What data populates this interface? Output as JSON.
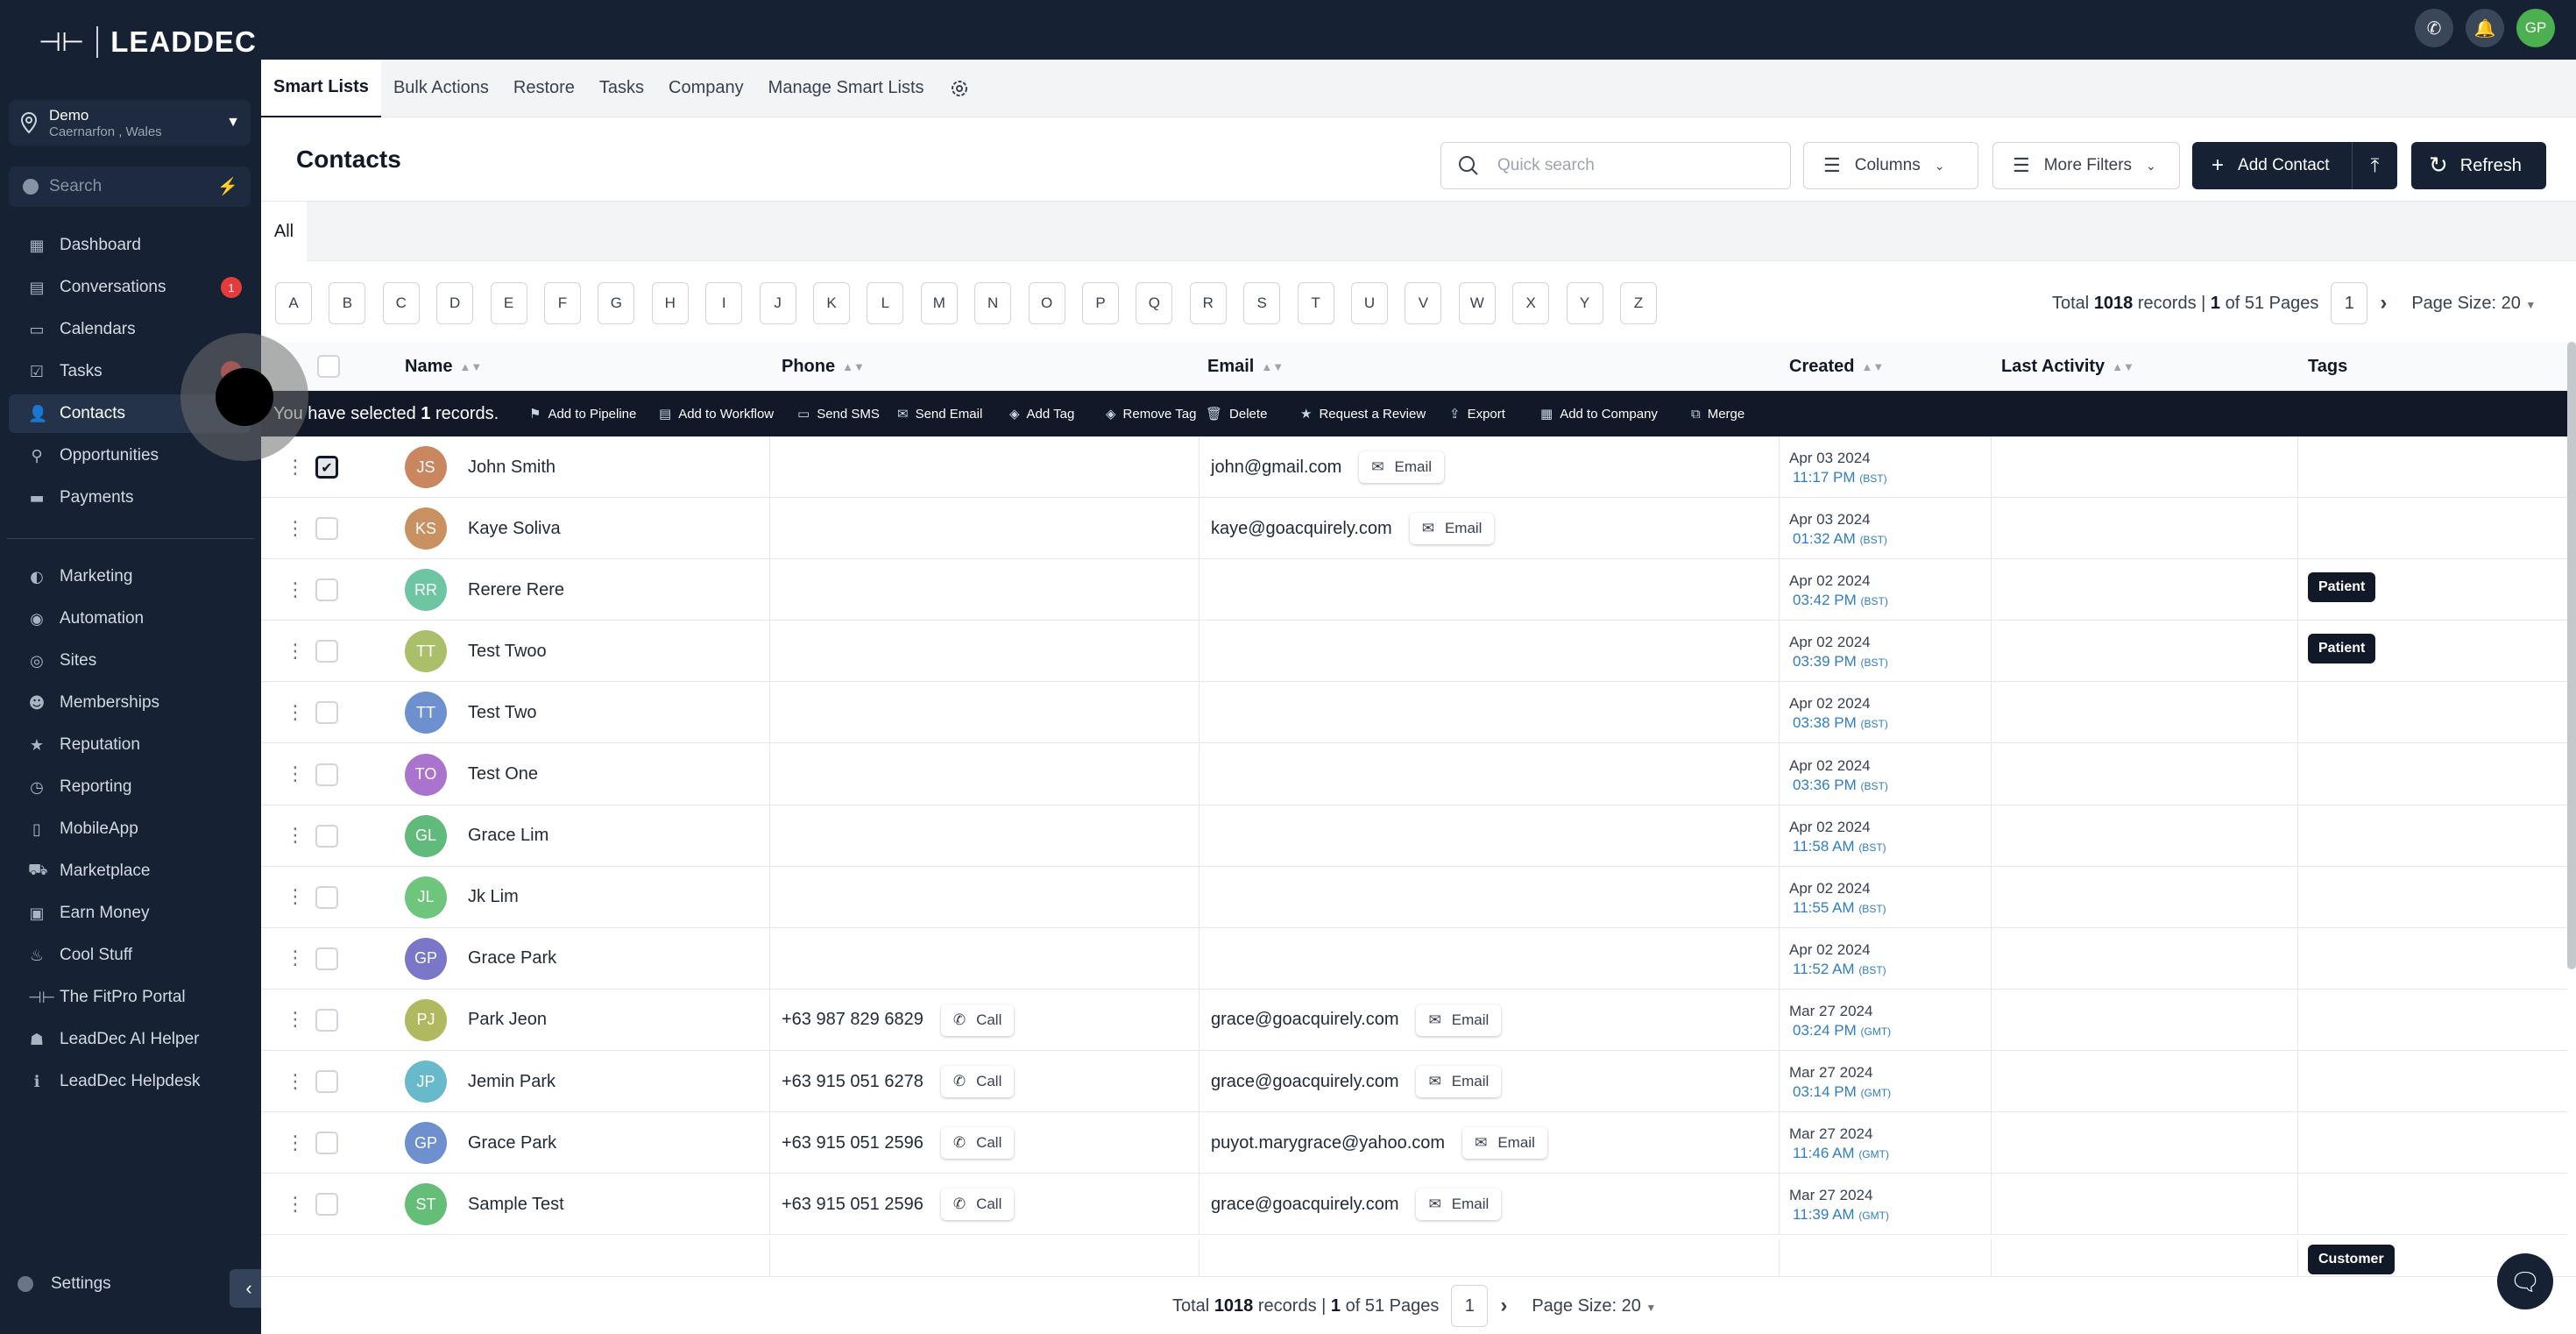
{
  "app": {
    "logo_mark": "⊣⊢",
    "name": "LEADDEC"
  },
  "location": {
    "name": "Demo",
    "address": "Caernarfon , Wales"
  },
  "sidebar_search": {
    "placeholder": "Search"
  },
  "nav": [
    {
      "label": "Dashboard",
      "icon": "▦"
    },
    {
      "label": "Conversations",
      "icon": "▤",
      "badge": "1"
    },
    {
      "label": "Calendars",
      "icon": "▭"
    },
    {
      "label": "Tasks",
      "icon": "☑",
      "badge": " "
    },
    {
      "label": "Contacts",
      "icon": "👤"
    },
    {
      "label": "Opportunities",
      "icon": "⚲"
    },
    {
      "label": "Payments",
      "icon": "▬"
    },
    {
      "label": "Marketing",
      "icon": "◐"
    },
    {
      "label": "Automation",
      "icon": "◉"
    },
    {
      "label": "Sites",
      "icon": "◎"
    },
    {
      "label": "Memberships",
      "icon": "☻"
    },
    {
      "label": "Reputation",
      "icon": "★"
    },
    {
      "label": "Reporting",
      "icon": "◷"
    },
    {
      "label": "MobileApp",
      "icon": "▯"
    },
    {
      "label": "Marketplace",
      "icon": "⛟"
    },
    {
      "label": "Earn Money",
      "icon": "▣"
    },
    {
      "label": "Cool Stuff",
      "icon": "♨"
    },
    {
      "label": "The FitPro Portal",
      "icon": "⊣⊢"
    },
    {
      "label": "LeadDec AI Helper",
      "icon": "☗"
    },
    {
      "label": "LeadDec Helpdesk",
      "icon": "ℹ"
    }
  ],
  "settings_label": "Settings",
  "topbar": {
    "avatar_initials": "GP"
  },
  "tabs": [
    "Smart Lists",
    "Bulk Actions",
    "Restore",
    "Tasks",
    "Company",
    "Manage Smart Lists"
  ],
  "header": {
    "title": "Contacts",
    "search_placeholder": "Quick search",
    "columns_label": "Columns",
    "filters_label": "More Filters",
    "add_contact_label": "Add Contact",
    "refresh_label": "Refresh"
  },
  "all_tab": "All",
  "alphabet": [
    "A",
    "B",
    "C",
    "D",
    "E",
    "F",
    "G",
    "H",
    "I",
    "J",
    "K",
    "L",
    "M",
    "N",
    "O",
    "P",
    "Q",
    "R",
    "S",
    "T",
    "U",
    "V",
    "W",
    "X",
    "Y",
    "Z"
  ],
  "pagination": {
    "total_prefix": "Total",
    "total": "1018",
    "records_text": "records |",
    "page": "1",
    "of_text": "of 51 Pages",
    "current_page": "1",
    "page_size": "Page Size: 20"
  },
  "columns": {
    "name": "Name",
    "phone": "Phone",
    "email": "Email",
    "created": "Created",
    "last_activity": "Last Activity",
    "tags": "Tags"
  },
  "selection": {
    "prefix": "You have selected",
    "count": "1",
    "suffix": "records."
  },
  "bulk_actions": [
    "Add to Pipeline",
    "Add to Workflow",
    "Send SMS",
    "Send Email",
    "Add Tag",
    "Remove Tag",
    "Delete",
    "Request a Review",
    "Export",
    "Add to Company",
    "Merge"
  ],
  "pill_labels": {
    "email": "Email",
    "call": "Call"
  },
  "rows": [
    {
      "initials": "JS",
      "name": "John Smith",
      "phone": "",
      "email": "john@gmail.com",
      "date": "Apr 03 2024",
      "time": "11:17 PM",
      "tz": "(BST)",
      "tag": "",
      "color": "#c47a4e",
      "checked": true
    },
    {
      "initials": "KS",
      "name": "Kaye Soliva",
      "phone": "",
      "email": "kaye@goacquirely.com",
      "date": "Apr 03 2024",
      "time": "01:32 AM",
      "tz": "(BST)",
      "tag": "",
      "color": "#c48552"
    },
    {
      "initials": "RR",
      "name": "Rerere Rere",
      "phone": "",
      "email": "",
      "date": "Apr 02 2024",
      "time": "03:42 PM",
      "tz": "(BST)",
      "tag": "Patient",
      "color": "#5fbf98"
    },
    {
      "initials": "TT",
      "name": "Test Twoo",
      "phone": "",
      "email": "",
      "date": "Apr 02 2024",
      "time": "03:39 PM",
      "tz": "(BST)",
      "tag": "Patient",
      "color": "#a3b85a"
    },
    {
      "initials": "TT",
      "name": "Test Two",
      "phone": "",
      "email": "",
      "date": "Apr 02 2024",
      "time": "03:38 PM",
      "tz": "(BST)",
      "tag": "",
      "color": "#5f84c9"
    },
    {
      "initials": "TO",
      "name": "Test One",
      "phone": "",
      "email": "",
      "date": "Apr 02 2024",
      "time": "03:36 PM",
      "tz": "(BST)",
      "tag": "",
      "color": "#a064c9"
    },
    {
      "initials": "GL",
      "name": "Grace Lim",
      "phone": "",
      "email": "",
      "date": "Apr 02 2024",
      "time": "11:58 AM",
      "tz": "(BST)",
      "tag": "",
      "color": "#4eb36e"
    },
    {
      "initials": "JL",
      "name": "Jk Lim",
      "phone": "",
      "email": "",
      "date": "Apr 02 2024",
      "time": "11:55 AM",
      "tz": "(BST)",
      "tag": "",
      "color": "#5fbf6e"
    },
    {
      "initials": "GP",
      "name": "Grace Park",
      "phone": "",
      "email": "",
      "date": "Apr 02 2024",
      "time": "11:52 AM",
      "tz": "(BST)",
      "tag": "",
      "color": "#6c69c4"
    },
    {
      "initials": "PJ",
      "name": "Park Jeon",
      "phone": "+63 987 829 6829",
      "email": "grace@goacquirely.com",
      "date": "Mar 27 2024",
      "time": "03:24 PM",
      "tz": "(GMT)",
      "tag": "",
      "color": "#a8b24e"
    },
    {
      "initials": "JP",
      "name": "Jemin Park",
      "phone": "+63 915 051 6278",
      "email": "grace@goacquirely.com",
      "date": "Mar 27 2024",
      "time": "03:14 PM",
      "tz": "(GMT)",
      "tag": "",
      "color": "#58b2c4"
    },
    {
      "initials": "GP",
      "name": "Grace Park",
      "phone": "+63 915 051 2596",
      "email": "puyot.marygrace@yahoo.com",
      "date": "Mar 27 2024",
      "time": "11:46 AM",
      "tz": "(GMT)",
      "tag": "",
      "color": "#5f84c9"
    },
    {
      "initials": "ST",
      "name": "Sample Test",
      "phone": "+63 915 051 2596",
      "email": "grace@goacquirely.com",
      "date": "Mar 27 2024",
      "time": "11:39 AM",
      "tz": "(GMT)",
      "tag": "",
      "color": "#55b76a"
    }
  ],
  "partial_row_tag": "Customer"
}
